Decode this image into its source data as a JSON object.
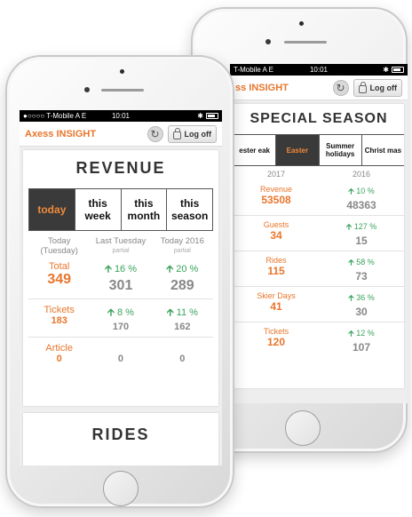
{
  "back_phone": {
    "status": {
      "carrier": "T-Mobile A  E",
      "time": "10:01",
      "bluetooth": "✱"
    },
    "appbar": {
      "title": "ss INSIGHT",
      "refresh_icon": "refresh-icon",
      "logoff_label": "Log off"
    },
    "section_title": "SPECIAL SEASON",
    "tabs": [
      {
        "label": "ester eak",
        "active": false
      },
      {
        "label": "Easter",
        "active": true
      },
      {
        "label": "Summer holidays",
        "active": false
      },
      {
        "label": "Christ mas",
        "active": false
      }
    ],
    "years": [
      "2017",
      "2016"
    ],
    "rows": [
      {
        "label": "Revenue",
        "value": "53508",
        "pct": "10 %",
        "prev": "48363"
      },
      {
        "label": "Guests",
        "value": "34",
        "pct": "127 %",
        "prev": "15"
      },
      {
        "label": "Rides",
        "value": "115",
        "pct": "58 %",
        "prev": "73"
      },
      {
        "label": "Skier Days",
        "value": "41",
        "pct": "36 %",
        "prev": "30"
      },
      {
        "label": "Tickets",
        "value": "120",
        "pct": "12 %",
        "prev": "107"
      }
    ]
  },
  "front_phone": {
    "status": {
      "carrier": "T-Mobile A  E",
      "time": "10:01",
      "bluetooth": "✱"
    },
    "appbar": {
      "title": "Axess INSIGHT",
      "refresh_icon": "refresh-icon",
      "logoff_label": "Log off"
    },
    "section_title": "REVENUE",
    "tabs": [
      {
        "label": "today",
        "active": true
      },
      {
        "label": "this week",
        "active": false
      },
      {
        "label": "this month",
        "active": false
      },
      {
        "label": "this season",
        "active": false
      }
    ],
    "columns": [
      {
        "main": "Today (Tuesday)",
        "sub": ""
      },
      {
        "main": "Last Tuesday",
        "sub": "partial"
      },
      {
        "main": "Today 2016",
        "sub": "partial"
      }
    ],
    "rows": [
      {
        "label": "Total",
        "value": "349",
        "pct1": "16 %",
        "cmp1": "301",
        "pct2": "20 %",
        "cmp2": "289"
      },
      {
        "label": "Tickets",
        "value": "183",
        "pct1": "8 %",
        "cmp1": "170",
        "pct2": "11 %",
        "cmp2": "162"
      },
      {
        "label": "Article",
        "value": "0",
        "pct1": "",
        "cmp1": "0",
        "pct2": "",
        "cmp2": "0"
      }
    ],
    "next_section_title": "RIDES"
  },
  "colors": {
    "accent": "#e8762c",
    "positive": "#3aa35c",
    "muted": "#888888",
    "active_tab_bg": "#3a3a3a"
  }
}
